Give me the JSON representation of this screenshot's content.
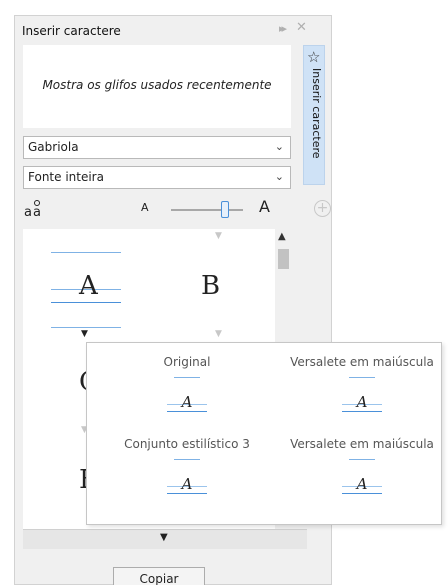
{
  "docker": {
    "title": "Inserir caractere",
    "side_tab_label": "Inserir caractere",
    "recent_placeholder": "Mostra os glifos usados recentemente",
    "font_dropdown": {
      "value": "Gabriola"
    },
    "range_dropdown": {
      "value": "Fonte inteira"
    },
    "zoom_small_label": "A",
    "zoom_large_label": "A",
    "glyphs": [
      "A",
      "B",
      "C",
      "E"
    ],
    "copy_button": "Copiar"
  },
  "popup": {
    "variants": [
      {
        "label": "Original",
        "glyph": "A"
      },
      {
        "label": "Versalete em maiúscula",
        "glyph": "A"
      },
      {
        "label": "Conjunto estilístico 3",
        "glyph": "A"
      },
      {
        "label": "Versalete em maiúscula",
        "glyph": "A"
      }
    ]
  },
  "colors": {
    "accent": "#4a90d9",
    "guide": "#7fb2e5",
    "tab_bg": "#cfe2f6"
  }
}
